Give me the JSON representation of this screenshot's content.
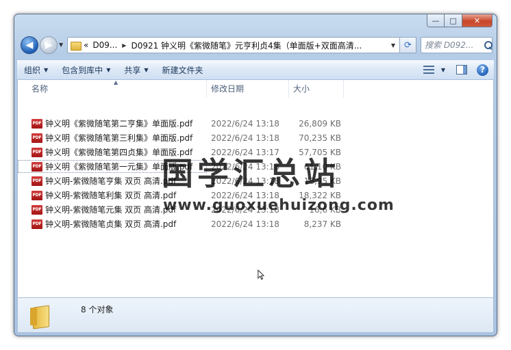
{
  "address": {
    "history_chevron": "«",
    "crumbs": [
      "D09...",
      "D0921 钟义明《紫微随笔》元亨利贞4集（单面版+双面高清..."
    ]
  },
  "search": {
    "placeholder": "搜索 D092..."
  },
  "toolbar": {
    "organize": "组织",
    "include_in_library": "包含到库中",
    "share": "共享",
    "new_folder": "新建文件夹"
  },
  "columns": {
    "name": "名称",
    "date_modified": "修改日期",
    "size": "大小"
  },
  "files": [
    {
      "name": "钟义明《紫微随笔第二亨集》单面版.pdf",
      "date": "2022/6/24 13:18",
      "size": "26,809 KB",
      "icon": "pdf-icon"
    },
    {
      "name": "钟义明《紫微随笔第三利集》单面版.pdf",
      "date": "2022/6/24 13:18",
      "size": "70,235 KB",
      "icon": "pdf-icon"
    },
    {
      "name": "钟义明《紫微随笔第四贞集》单面版.pdf",
      "date": "2022/6/24 13:17",
      "size": "57,705 KB",
      "icon": "pdf-icon"
    },
    {
      "name": "钟义明《紫微随笔第一元集》单面版.pdf",
      "date": "2022/6/24 13:18",
      "size": "61,10 KB",
      "icon": "pdf-icon"
    },
    {
      "name": "钟义明-紫微随笔亨集 双页 高清.pdf",
      "date": "2022/6/24 13:18",
      "size": "18,95 KB",
      "icon": "pdf-icon"
    },
    {
      "name": "钟义明-紫微随笔利集 双页 高清.pdf",
      "date": "2022/6/24 13:18",
      "size": "18,322 KB",
      "icon": "pdf-icon"
    },
    {
      "name": "钟义明-紫微随笔元集 双页 高清.pdf",
      "date": "2022/6/24 13:18",
      "size": "16,6 KB",
      "icon": "pdf-icon"
    },
    {
      "name": "钟义明-紫微随笔贞集 双页 高清.pdf",
      "date": "2022/6/24 13:18",
      "size": "8,237 KB",
      "icon": "pdf-icon"
    }
  ],
  "watermark": {
    "text": "国学汇总站",
    "url": "www.guoxuehuizong.com"
  },
  "status": {
    "item_count": "8 个对象"
  },
  "colors": {
    "toolbar_text": "#1e395b",
    "header_text": "#4c607a",
    "meta_text": "#6d6d6d"
  }
}
